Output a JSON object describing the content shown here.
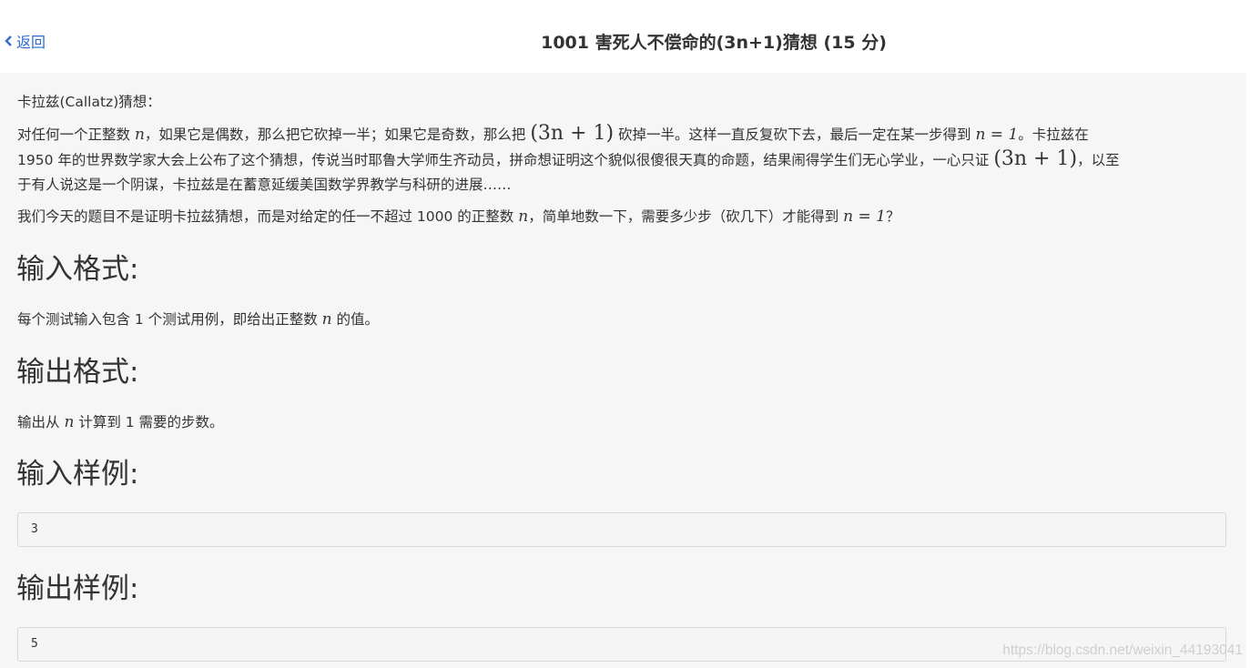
{
  "header": {
    "back_label": "返回",
    "title": "1001 害死人不偿命的(3n+1)猜想 (15 分)"
  },
  "problem": {
    "intro_title": "卡拉兹(Callatz)猜想：",
    "p1_a": "对任何一个正整数 ",
    "var_n": "n",
    "p1_b": "，如果它是偶数，那么把它砍掉一半；如果它是奇数，那么把 ",
    "expr_3n1": "(3n + 1)",
    "p1_c": " 砍掉一半。这样一直反复砍下去，最后一定在某一步得到 ",
    "expr_n_eq_1": "n = 1",
    "p1_d": "。卡拉兹在",
    "p2_a": "1950 年的世界数学家大会上公布了这个猜想，传说当时耶鲁大学师生齐动员，拼命想证明这个貌似很傻很天真的命题，结果闹得学生们无心学业，一心只证 ",
    "p2_b": "，以至",
    "p3": "于有人说这是一个阴谋，卡拉兹是在蓄意延缓美国数学界教学与科研的进展……",
    "p4_a": "我们今天的题目不是证明卡拉兹猜想，而是对给定的任一不超过 1000 的正整数 ",
    "p4_b": "，简单地数一下，需要多少步（砍几下）才能得到 ",
    "p4_c": "？"
  },
  "input_format": {
    "heading": "输入格式:",
    "text_a": "每个测试输入包含 1 个测试用例，即给出正整数 ",
    "text_b": " 的值。"
  },
  "output_format": {
    "heading": "输出格式:",
    "text_a": "输出从 ",
    "text_b": " 计算到 1 需要的步数。"
  },
  "sample_input": {
    "heading": "输入样例:",
    "code": "3"
  },
  "sample_output": {
    "heading": "输出样例:",
    "code": "5"
  },
  "watermark": "https://blog.csdn.net/weixin_44193041",
  "colors": {
    "link": "#2d6bd6",
    "panel_bg": "#f6f6f6",
    "text": "#333333"
  }
}
